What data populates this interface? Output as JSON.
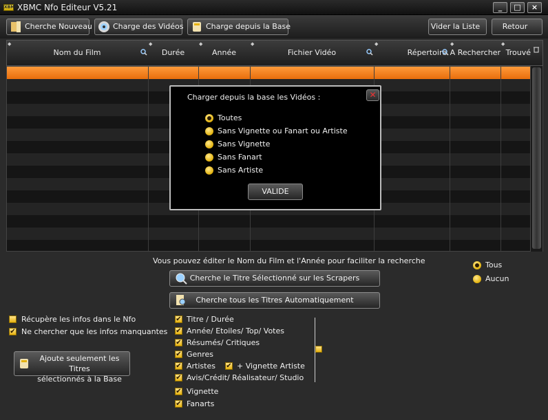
{
  "window": {
    "title": "XBMC Nfo Editeur V5.21",
    "icon_text": "XBMC",
    "minimize_glyph": "_",
    "maximize_glyph": "□",
    "close_glyph": "×"
  },
  "toolbar": {
    "search_new_label": "Cherche Nouveau",
    "load_videos_label": "Charge des Vidéos",
    "load_from_db_label": "Charge depuis la Base",
    "clear_list_label": "Vider la Liste",
    "back_label": "Retour"
  },
  "grid": {
    "columns": {
      "film_name": "Nom du Film",
      "duration": "Durée",
      "year": "Année",
      "video_file": "Fichier Vidéo",
      "directory": "Répertoire",
      "to_search": "A Rechercher",
      "found": "Trouvé"
    },
    "sort_glyph": "◆"
  },
  "dialog": {
    "title": "Charger depuis la base les Vidéos :",
    "close_glyph": "✕",
    "options": [
      {
        "label": "Toutes",
        "selected": true
      },
      {
        "label": "Sans Vignette ou Fanart ou Artiste",
        "selected": false
      },
      {
        "label": "Sans Vignette",
        "selected": false
      },
      {
        "label": "Sans Fanart",
        "selected": false
      },
      {
        "label": "Sans Artiste",
        "selected": false
      }
    ],
    "validate_label": "VALIDE"
  },
  "search": {
    "hint": "Vous pouvez éditer le Nom du Film et l'Année pour faciliter la recherche",
    "search_selected_label": "Cherche le Titre Sélectionné sur les Scrapers",
    "search_all_label": "Cherche tous les Titres Automatiquement"
  },
  "scope": {
    "all_label": "Tous",
    "none_label": "Aucun"
  },
  "options_left": {
    "get_from_nfo": {
      "label": "Récupère les infos dans le Nfo",
      "checked": false
    },
    "missing_only": {
      "label": "Ne chercher que les infos manquantes",
      "checked": true
    }
  },
  "add_selected": {
    "line1": "Ajoute seulement les Titres",
    "line2": "sélectionnés à la Base"
  },
  "fields": [
    {
      "label": "Titre / Durée",
      "checked": true
    },
    {
      "label": "Année/ Etoiles/ Top/ Votes",
      "checked": true
    },
    {
      "label": "Résumés/ Critiques",
      "checked": true
    },
    {
      "label": "Genres",
      "checked": true
    },
    {
      "label": "Artistes",
      "checked": true
    },
    {
      "label": "Avis/Crédit/ Réalisateur/ Studio",
      "checked": true
    },
    {
      "label": "Vignette",
      "checked": true
    },
    {
      "label": "Fanarts",
      "checked": true
    }
  ],
  "artist_thumb": {
    "label": "+ Vignette Artiste",
    "checked": true
  },
  "check_glyph": "✔",
  "colors": {
    "accent_orange": "#f08020",
    "checkbox_yellow": "#e6b20f"
  }
}
